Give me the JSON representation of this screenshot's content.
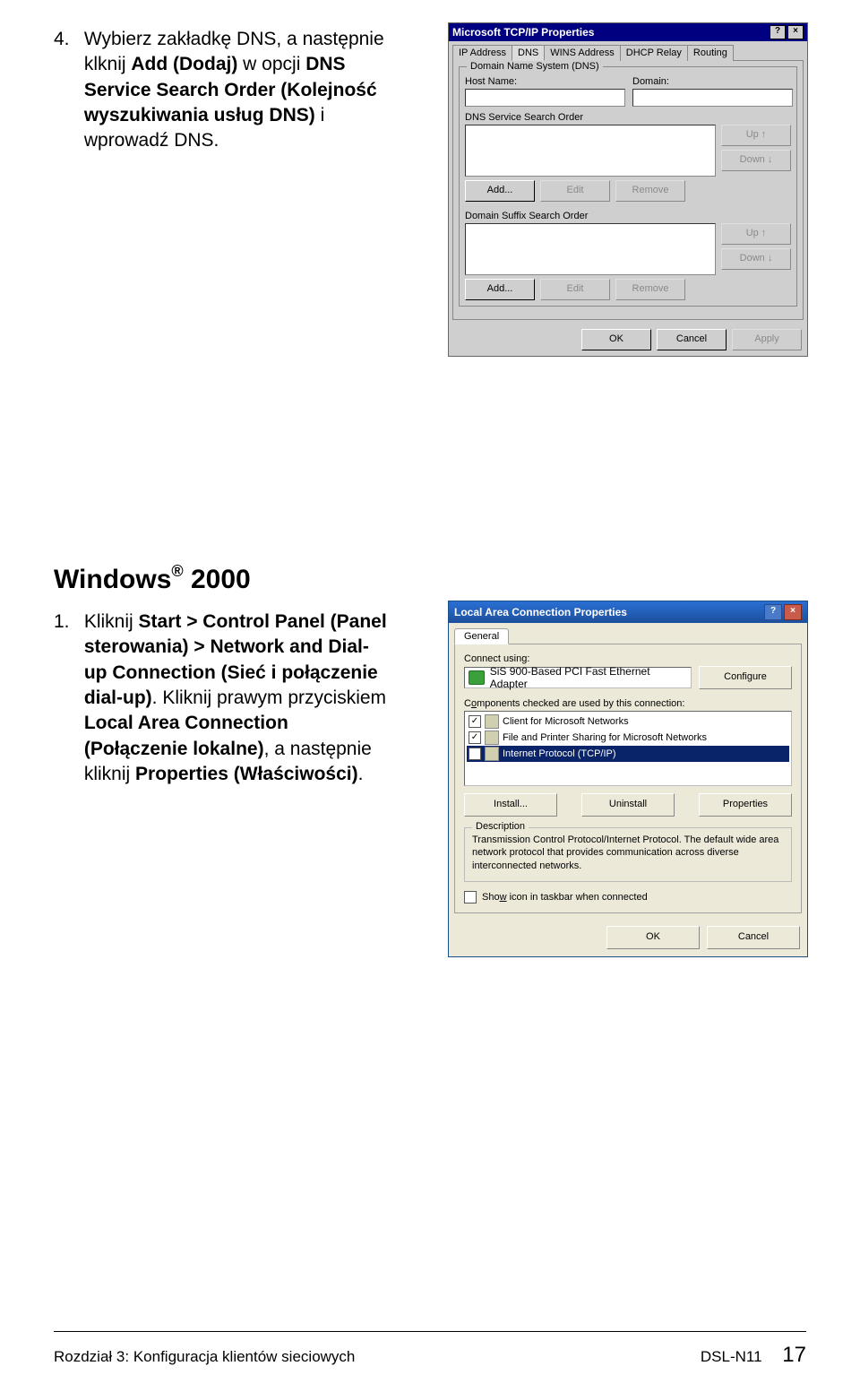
{
  "step4": {
    "number": "4.",
    "pre": "Wybierz zakładkę DNS, a następnie klknij ",
    "bold1": "Add (Dodaj)",
    "mid": " w opcji ",
    "bold2": "DNS Service Search Order (Kolejność wyszukiwania usług DNS)",
    "post": " i wprowadź DNS."
  },
  "tcpip": {
    "title": "Microsoft TCP/IP Properties",
    "tabs": [
      "IP Address",
      "DNS",
      "WINS Address",
      "DHCP Relay",
      "Routing"
    ],
    "active_tab": "DNS",
    "group1_legend": "Domain Name System (DNS)",
    "host_label": "Host Name:",
    "domain_label": "Domain:",
    "group2_label": "DNS Service Search Order",
    "group3_label": "Domain Suffix Search Order",
    "btn_up": "Up ↑",
    "btn_down": "Down ↓",
    "btn_add": "Add...",
    "btn_edit": "Edit",
    "btn_remove": "Remove",
    "btn_ok": "OK",
    "btn_cancel": "Cancel",
    "btn_apply": "Apply"
  },
  "win2000": {
    "heading_pre": "Windows",
    "heading_reg": "®",
    "heading_post": " 2000"
  },
  "step1": {
    "number": "1.",
    "pre": "Kliknij ",
    "bold1": "Start > Control Panel (Panel sterowania) > Network and Dial-up Connection (Sieć i połączenie dial-up)",
    "mid": ". Kliknij prawym przyciskiem ",
    "bold2": "Local Area Connection (Połączenie lokalne)",
    "mid2": ", a następnie kliknij ",
    "bold3": "Properties (Właściwości)",
    "post": "."
  },
  "lan": {
    "title": "Local Area Connection Properties",
    "tab_general": "General",
    "connect_using": "Connect using:",
    "adapter": "SiS 900-Based PCI Fast Ethernet Adapter",
    "configure": "Configure",
    "components_text_pre": "C",
    "components_text_u": "o",
    "components_text_post": "mponents checked are used by this connection:",
    "items": [
      {
        "label": "Client for Microsoft Networks",
        "checked": true,
        "selected": false
      },
      {
        "label": "File and Printer Sharing for Microsoft Networks",
        "checked": true,
        "selected": false
      },
      {
        "label": "Internet Protocol (TCP/IP)",
        "checked": true,
        "selected": true
      }
    ],
    "btn_install": "Install...",
    "btn_uninstall": "Uninstall",
    "btn_properties": "Properties",
    "desc_legend": "Description",
    "desc_text": "Transmission Control Protocol/Internet Protocol. The default wide area network protocol that provides communication across diverse interconnected networks.",
    "show_icon_pre": "Sho",
    "show_icon_u": "w",
    "show_icon_post": " icon in taskbar when connected",
    "btn_ok": "OK",
    "btn_cancel": "Cancel"
  },
  "footer": {
    "chapter": "Rozdział 3: Konfiguracja klientów sieciowych",
    "model": "DSL-N11",
    "page": "17"
  }
}
